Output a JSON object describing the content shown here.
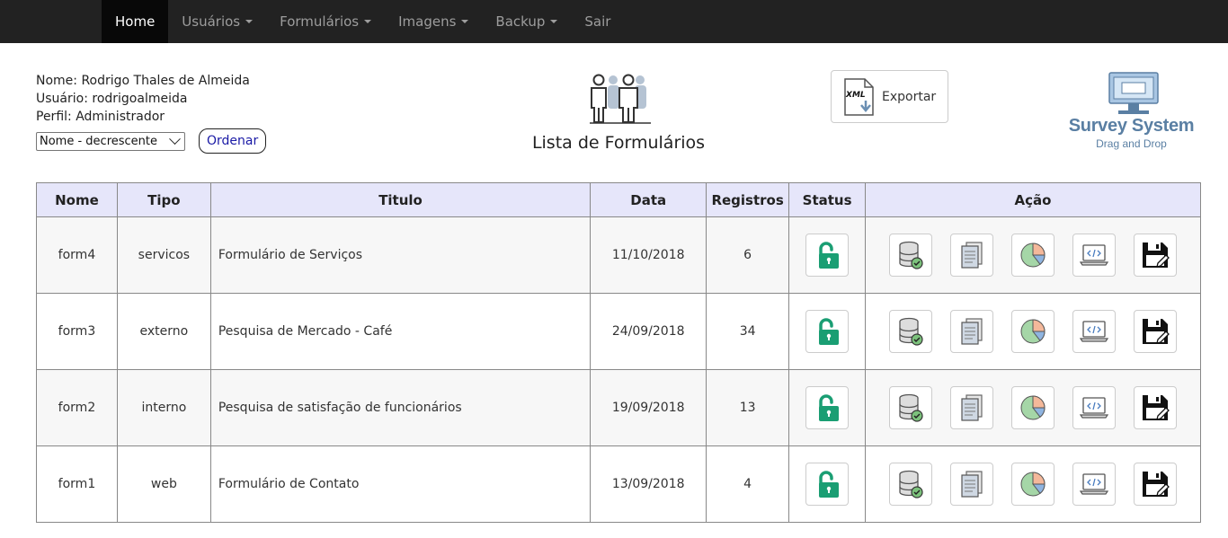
{
  "nav": {
    "items": [
      {
        "label": "Home",
        "active": true,
        "dropdown": false
      },
      {
        "label": "Usuários",
        "active": false,
        "dropdown": true
      },
      {
        "label": "Formulários",
        "active": false,
        "dropdown": true
      },
      {
        "label": "Imagens",
        "active": false,
        "dropdown": true
      },
      {
        "label": "Backup",
        "active": false,
        "dropdown": true
      },
      {
        "label": "Sair",
        "active": false,
        "dropdown": false
      }
    ]
  },
  "user": {
    "name_line": "Nome: Rodrigo Thales de Almeida",
    "user_line": "Usuário: rodrigoalmeida",
    "profile_line": "Perfil: Administrador"
  },
  "sort": {
    "selected": "Nome - decrescente",
    "button": "Ordenar"
  },
  "page": {
    "title": "Lista de Formulários"
  },
  "export": {
    "icon_text": "XML",
    "label": "Exportar"
  },
  "logo": {
    "title": "Survey System",
    "subtitle": "Drag and Drop"
  },
  "table": {
    "headers": [
      "Nome",
      "Tipo",
      "Titulo",
      "Data",
      "Registros",
      "Status",
      "Ação"
    ],
    "rows": [
      {
        "nome": "form4",
        "tipo": "servicos",
        "titulo": "Formulário de Serviços",
        "data": "11/10/2018",
        "registros": "6"
      },
      {
        "nome": "form3",
        "tipo": "externo",
        "titulo": "Pesquisa de Mercado - Café",
        "data": "24/09/2018",
        "registros": "34"
      },
      {
        "nome": "form2",
        "tipo": "interno",
        "titulo": "Pesquisa de satisfação de funcionários",
        "data": "19/09/2018",
        "registros": "13"
      },
      {
        "nome": "form1",
        "tipo": "web",
        "titulo": "Formulário de Contato",
        "data": "13/09/2018",
        "registros": "4"
      }
    ],
    "status_icon": "unlock-icon",
    "action_icons": [
      "database-check-icon",
      "documents-icon",
      "pie-chart-icon",
      "laptop-code-icon",
      "save-edit-icon"
    ]
  },
  "colors": {
    "navbar_bg": "#222222",
    "nav_active_bg": "#080808",
    "header_bg": "#e6e6fa",
    "unlock_green": "#1a9e73",
    "logo_blue": "#5a7fa3"
  }
}
